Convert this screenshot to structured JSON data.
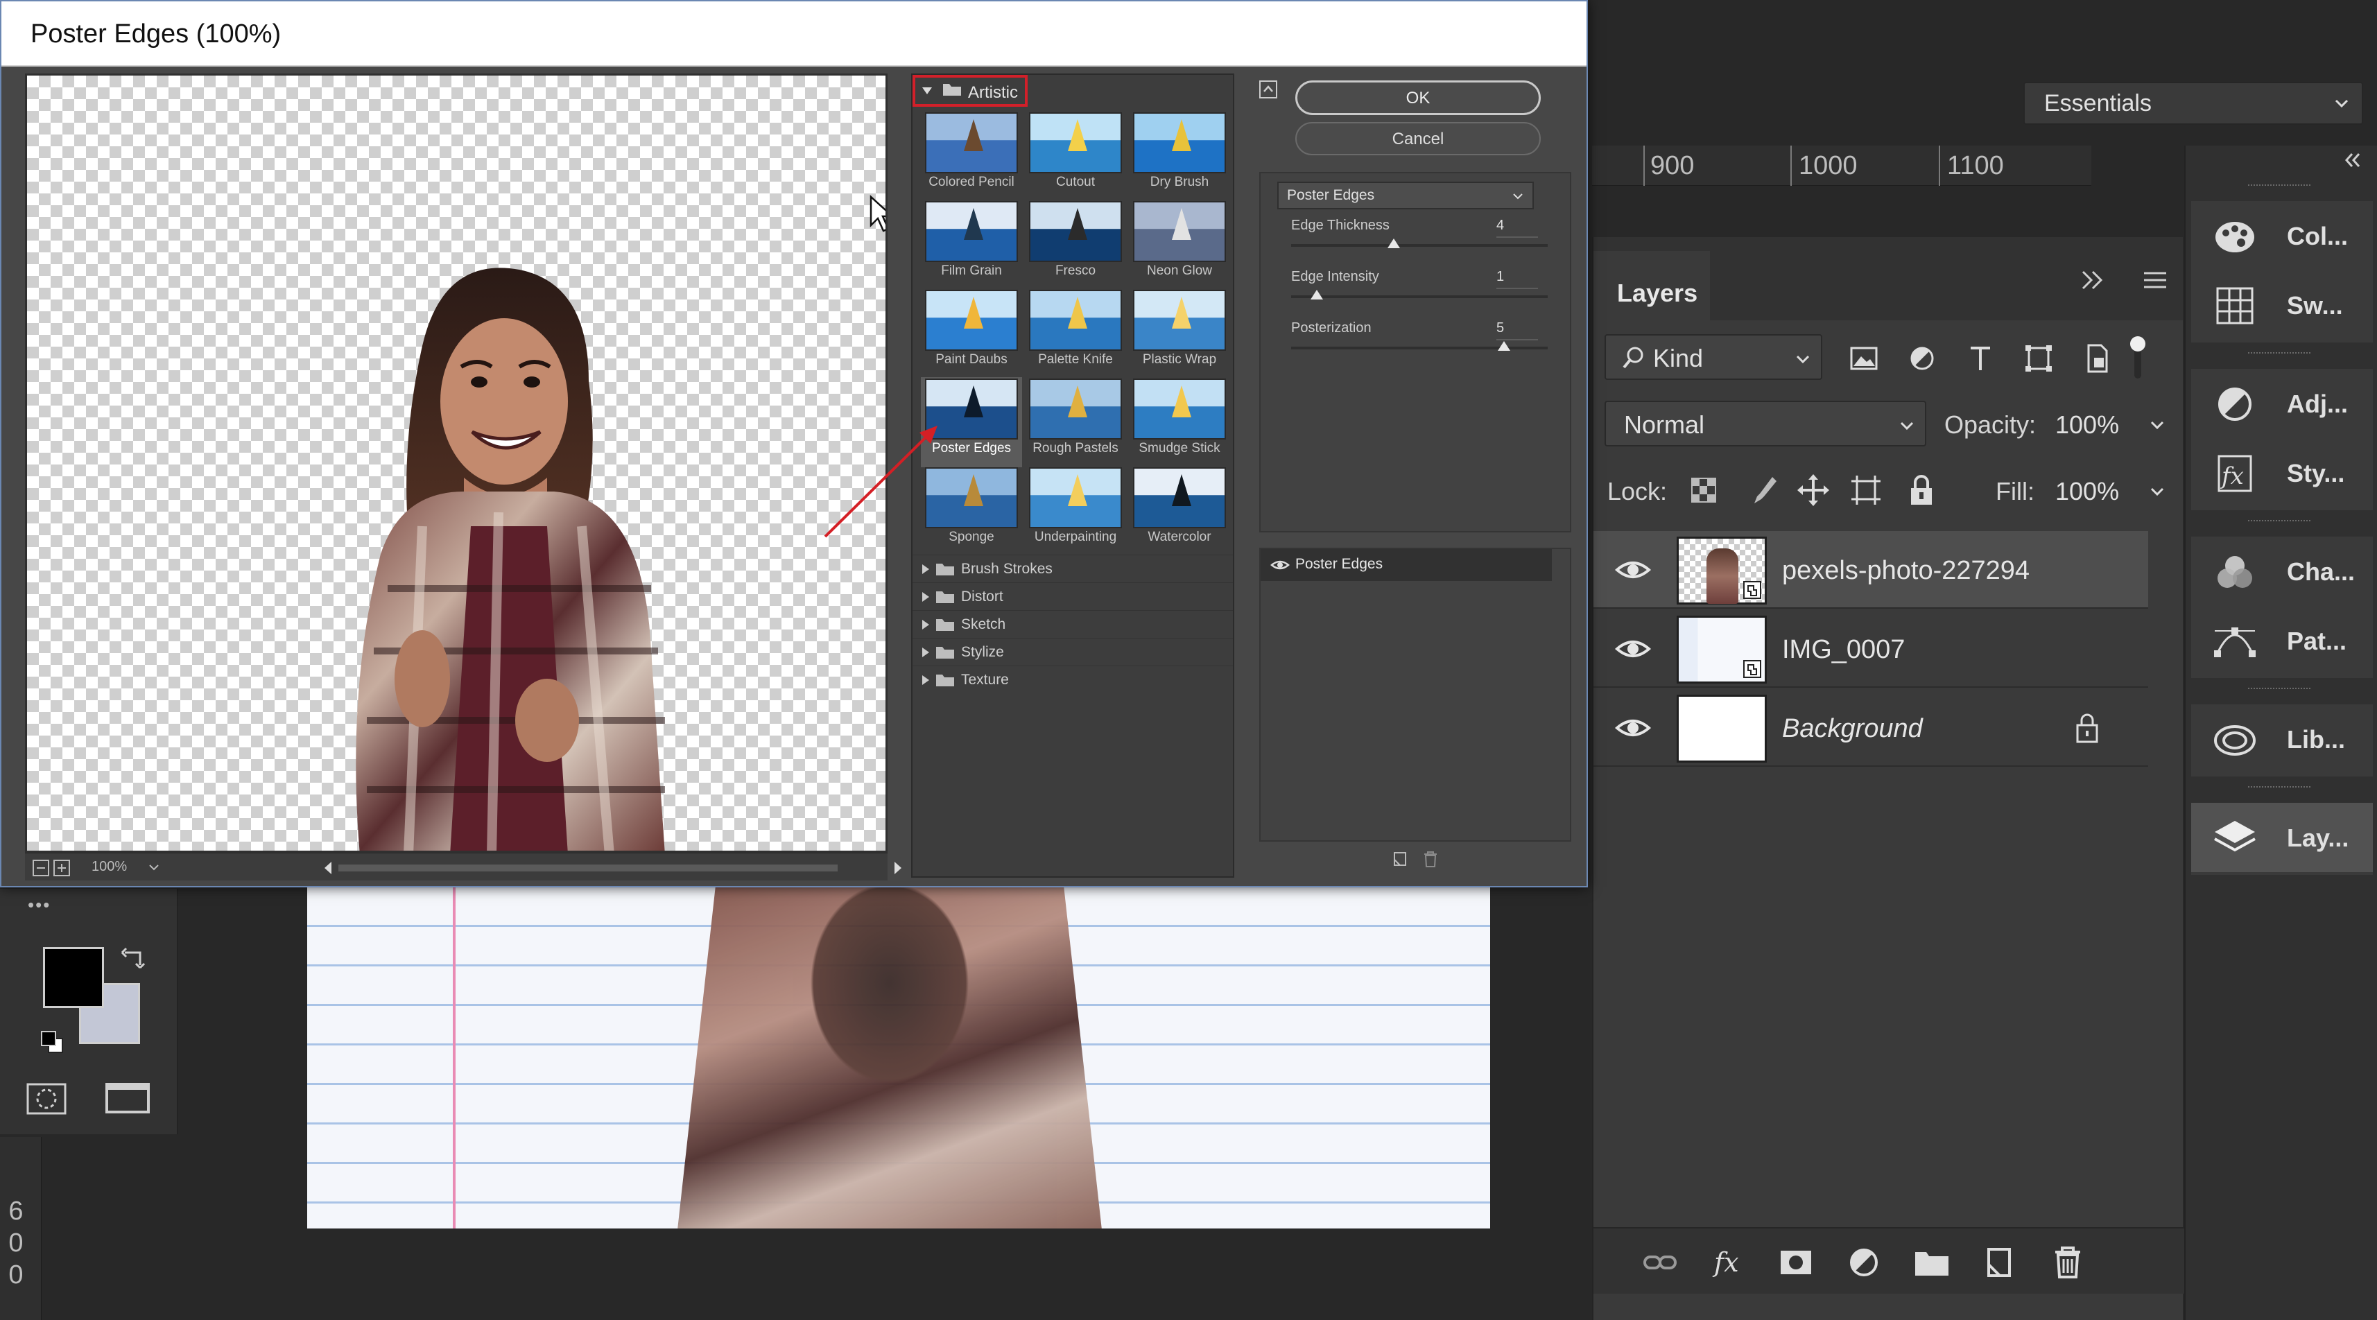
{
  "dialog": {
    "title": "Poster Edges (100%)",
    "zoom": "100%",
    "ok_label": "OK",
    "cancel_label": "Cancel",
    "gallery": {
      "open_category": "Artistic",
      "thumbnails": [
        {
          "label": "Colored Pencil"
        },
        {
          "label": "Cutout"
        },
        {
          "label": "Dry Brush"
        },
        {
          "label": "Film Grain"
        },
        {
          "label": "Fresco"
        },
        {
          "label": "Neon Glow"
        },
        {
          "label": "Paint Daubs"
        },
        {
          "label": "Palette Knife"
        },
        {
          "label": "Plastic Wrap"
        },
        {
          "label": "Poster Edges"
        },
        {
          "label": "Rough Pastels"
        },
        {
          "label": "Smudge Stick"
        },
        {
          "label": "Sponge"
        },
        {
          "label": "Underpainting"
        },
        {
          "label": "Watercolor"
        }
      ],
      "selected": "Poster Edges",
      "categories": [
        "Brush Strokes",
        "Distort",
        "Sketch",
        "Stylize",
        "Texture"
      ]
    },
    "settings": {
      "filter": "Poster Edges",
      "params": [
        {
          "label": "Edge Thickness",
          "value": "4",
          "fraction": 0.4
        },
        {
          "label": "Edge Intensity",
          "value": "1",
          "fraction": 0.1
        },
        {
          "label": "Posterization",
          "value": "5",
          "fraction": 0.83
        }
      ]
    },
    "effect_layers": [
      {
        "label": "Poster Edges"
      }
    ]
  },
  "workspace": {
    "name": "Essentials",
    "ruler_marks": [
      "900",
      "1000",
      "1100"
    ],
    "vertical_ruler_digits": "6\n0\n0"
  },
  "layers_panel": {
    "tab": "Layers",
    "filter_kind": "Kind",
    "blend_mode": "Normal",
    "opacity_label": "Opacity:",
    "opacity": "100%",
    "lock_label": "Lock:",
    "fill_label": "Fill:",
    "fill": "100%",
    "layers": [
      {
        "name": "pexels-photo-227294",
        "selected": true,
        "locked": false
      },
      {
        "name": "IMG_0007",
        "selected": false,
        "locked": false
      },
      {
        "name": "Background",
        "selected": false,
        "locked": true
      }
    ]
  },
  "dock": {
    "items": [
      {
        "label": "Col...",
        "icon": "color-icon"
      },
      {
        "label": "Sw...",
        "icon": "swatches-icon"
      },
      {
        "label": "Adj...",
        "icon": "adjustments-icon"
      },
      {
        "label": "Sty...",
        "icon": "styles-icon"
      },
      {
        "label": "Cha...",
        "icon": "channels-icon"
      },
      {
        "label": "Pat...",
        "icon": "paths-icon"
      },
      {
        "label": "Lib...",
        "icon": "libraries-icon"
      },
      {
        "label": "Lay...",
        "icon": "layers-icon"
      }
    ]
  }
}
